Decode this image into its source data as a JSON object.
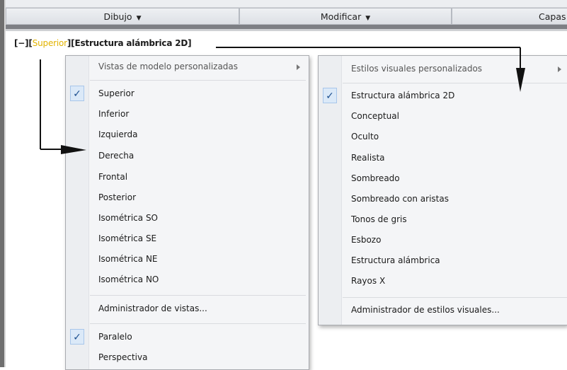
{
  "ribbon": {
    "panels": [
      {
        "label": "Dibujo"
      },
      {
        "label": "Modificar"
      },
      {
        "label": "Capas"
      }
    ]
  },
  "viewport": {
    "prefix": "[−][",
    "view": "Superior",
    "mid": "][",
    "style": "Estructura alámbrica 2D",
    "suffix": "]"
  },
  "views_menu": {
    "header": "Vistas de modelo personalizadas",
    "items": [
      "Superior",
      "Inferior",
      "Izquierda",
      "Derecha",
      "Frontal",
      "Posterior",
      "Isométrica SO",
      "Isométrica SE",
      "Isométrica NE",
      "Isométrica NO"
    ],
    "checked": "Superior",
    "manager": "Administrador de vistas...",
    "projection": [
      "Paralelo",
      "Perspectiva"
    ],
    "projection_checked": "Paralelo"
  },
  "styles_menu": {
    "header": "Estilos visuales personalizados",
    "items": [
      "Estructura alámbrica 2D",
      "Conceptual",
      "Oculto",
      "Realista",
      "Sombreado",
      "Sombreado con aristas",
      "Tonos de gris",
      "Esbozo",
      "Estructura alámbrica",
      "Rayos X"
    ],
    "checked": "Estructura alámbrica 2D",
    "manager": "Administrador de estilos visuales..."
  },
  "colors": {
    "highlight_label": "#e2b300",
    "check_bg": "#dbe9f8"
  }
}
